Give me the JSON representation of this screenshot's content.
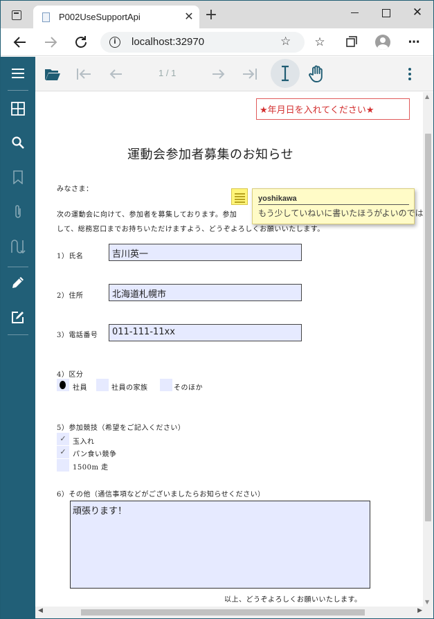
{
  "browser": {
    "tab_title": "P002UseSupportApi",
    "tab_close": "✕",
    "new_tab": "+",
    "url": "localhost:32970",
    "window_close": "✕"
  },
  "viewer": {
    "page_indicator": "1 / 1"
  },
  "document": {
    "date_note": "★年月日を入れてください★",
    "title": "運動会参加者募集のお知らせ",
    "greeting": "みなさま：",
    "intro_line1": "次の運動会に向けて、参加者を募集しております。参加",
    "intro_line2": "して、総務窓口までお持ちいただけますよう、どうぞよろしくお願いいたします。",
    "name_label": "1）氏名",
    "name_value": "吉川英一",
    "address_label": "2）住所",
    "address_value": "北海道札幌市",
    "phone_label": "3）電話番号",
    "phone_value": "011-111-11xx",
    "category_label": "4）区分",
    "category_options": [
      "社員",
      "社員の家族",
      "そのほか"
    ],
    "category_selected": "社員",
    "events_label": "5）参加競技（希望をご記入ください）",
    "events": [
      {
        "label": "玉入れ",
        "checked": true
      },
      {
        "label": "パン食い競争",
        "checked": true
      },
      {
        "label": "1500m 走",
        "checked": false
      }
    ],
    "check_mark": "✓",
    "other_label": "6）その他（通信事項などがございましたらお知らせください）",
    "other_value": "頑張ります！",
    "closing": "以上、どうぞよろしくお願いいたします。"
  },
  "annotation": {
    "author": "yoshikawa",
    "comment": "もう少していねいに書いたほうがよいのでは"
  }
}
